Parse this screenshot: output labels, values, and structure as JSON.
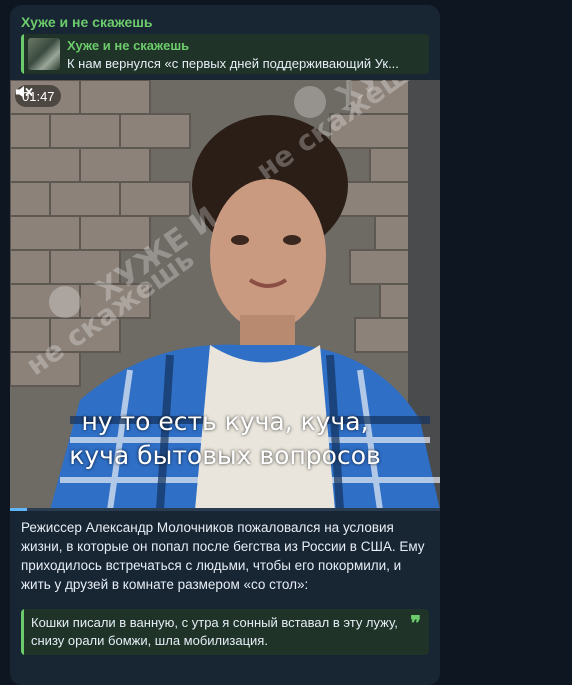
{
  "post": {
    "channel_name": "Хуже и не скажешь",
    "reply": {
      "title": "Хуже и не скажешь",
      "text": "К нам вернулся «с первых дней поддерживающий Ук..."
    },
    "video": {
      "duration": "01:47",
      "muted_icon": "speaker-muted-icon",
      "subtitle_line1": "ну то есть куча, куча,",
      "subtitle_line2": "куча бытовых вопросов",
      "watermark_line1": "ХУЖЕ И",
      "watermark_line2": "не скажешь",
      "progress_fraction": 0.04
    },
    "caption": "Режиссер Александр Молочников пожаловался на условия жизни, в которые он попал после бегства из России в США. Ему приходилось встречаться с людьми, чтобы его покормили, и жить у друзей в комнате размером «со стол»:",
    "quote": "Кошки писали в ванную, с утра я сонный вставал в эту лужу, снизу орали бомжи, шла мобилизация.",
    "quote_icon": "quote-icon"
  },
  "colors": {
    "background": "#0e1621",
    "bubble": "#182533",
    "accent_green": "#6ccb6b",
    "progress": "#5eb5f7"
  }
}
